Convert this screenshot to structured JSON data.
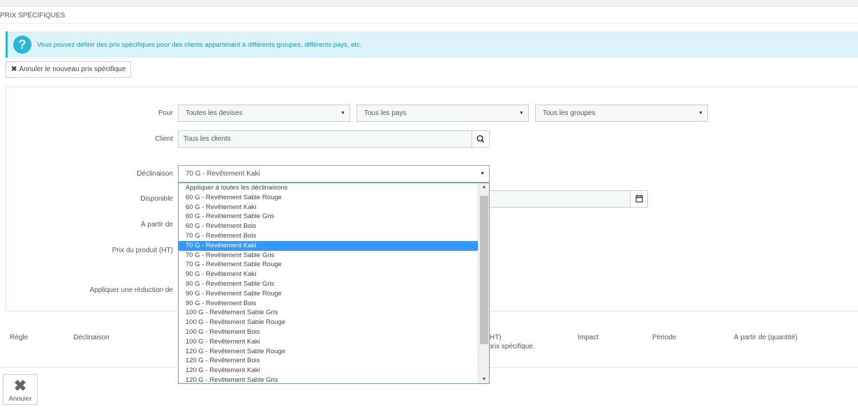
{
  "panel": {
    "title": "PRIX SPÉCIFIQUES"
  },
  "alert": {
    "icon": "question-icon",
    "text": "Vous pouvez définir des prix spécifiques pour des clients appartenant à différents groupes, différents pays, etc."
  },
  "cancel_new_button": "Annuler le nouveau prix spécifique",
  "form": {
    "pour_label": "Pour",
    "currency_value": "Toutes les devises",
    "country_value": "Tous les pays",
    "group_value": "Tous les groupes",
    "client_label": "Client",
    "client_value": "Tous les clients",
    "declinaison_label": "Déclinaison",
    "declinaison_value": "70 G - Revêtement Kaki",
    "disponible_label": "Disponible",
    "a_partir_label": "À partir de",
    "prix_label": "Prix du produit (HT)",
    "reduction_label": "Appliquer une réduction de"
  },
  "dropdown": {
    "options": [
      "Appliquer à toutes les déclinaisons",
      "60 G - Revêtement Sable Rouge",
      "60 G - Revêtement Kaki",
      "60 G - Revêtement Sable Gris",
      "60 G - Revêtement Bois",
      "70 G - Revêtement Bois",
      "70 G - Revêtement Kaki",
      "70 G - Revêtement Sable Gris",
      "70 G - Revêtement Sable Rouge",
      "90 G - Revêtement Kaki",
      "90 G - Revêtement Sable Gris",
      "90 G - Revêtement Sable Rouge",
      "90 G - Revêtement Bois",
      "100 G - Revêtement Sable Gris",
      "100 G - Revêtement Sable Rouge",
      "100 G - Revêtement Bois",
      "100 G - Revêtement Kaki",
      "120 G - Revêtement Sable Rouge",
      "120 G - Revêtement Bois",
      "120 G - Revêtement Kaki",
      "120 G - Revêtement Sable Gris"
    ],
    "selected_index": 6
  },
  "table": {
    "col_regle": "Règle",
    "col_declinaison": "Déclinaison",
    "col_ht_fragment": "HT)",
    "col_impact": "Impact",
    "col_periode": "Période",
    "col_quantite": "À partir de (quantité)",
    "empty_fragment": "prix spécifique."
  },
  "footer": {
    "cancel_label": "Annuler"
  },
  "colors": {
    "accent": "#25b9d7",
    "selected": "#3399ff",
    "alert_bg": "#dcf4f9"
  }
}
